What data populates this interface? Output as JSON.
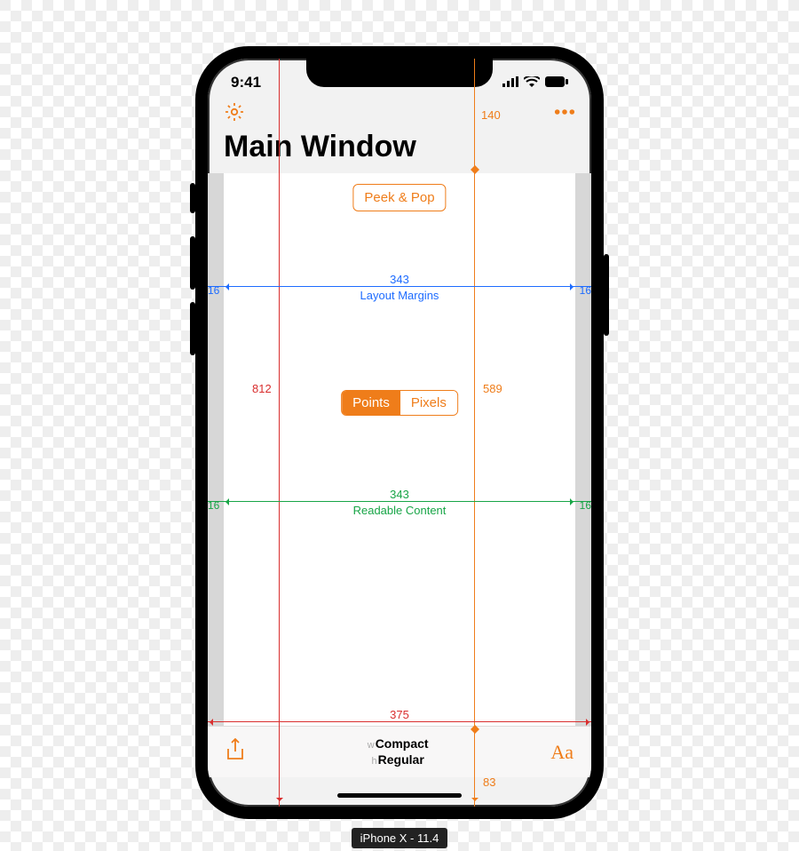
{
  "device_caption": "iPhone X - 11.4",
  "status": {
    "time": "9:41"
  },
  "nav": {
    "settings_icon": "gear-icon",
    "more_icon": "more-icon",
    "title": "Main Window"
  },
  "buttons": {
    "peek_pop": "Peek & Pop"
  },
  "segmented": {
    "points": "Points",
    "pixels": "Pixels",
    "selected": "Points"
  },
  "guides": {
    "safe_area": {
      "top_inset": "140",
      "content_height": "589",
      "bottom_inset": "83"
    },
    "screen": {
      "height": "812",
      "width": "375"
    },
    "layout_margins": {
      "left": "16",
      "width": "343",
      "right": "16",
      "label": "Layout Margins"
    },
    "readable_content": {
      "left": "16",
      "width": "343",
      "right": "16",
      "label": "Readable Content"
    }
  },
  "size_class": {
    "w_prefix": "w",
    "w_value": "Compact",
    "h_prefix": "h",
    "h_value": "Regular"
  },
  "toolbar": {
    "share_icon": "share-icon",
    "text_icon": "aa-icon"
  },
  "colors": {
    "orange": "#ef7d1a",
    "blue": "#1e6cff",
    "green": "#18a547",
    "red": "#d92f2f"
  }
}
